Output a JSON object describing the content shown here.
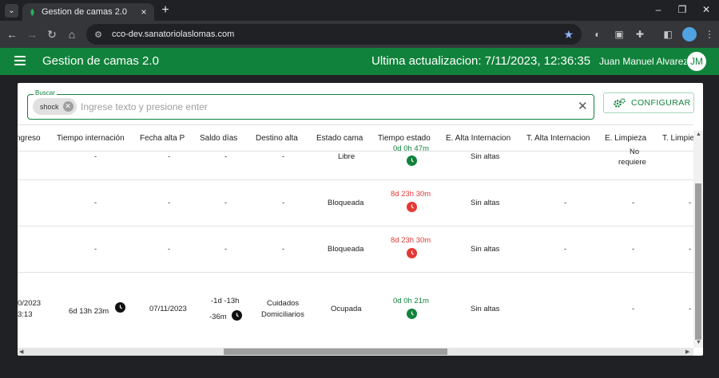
{
  "browser": {
    "tab_title": "Gestion de camas 2.0",
    "url": "cco-dev.sanatoriolaslomas.com"
  },
  "header": {
    "app_title": "Gestion de camas 2.0",
    "last_update": "Ultima actualizacion: 7/11/2023, 12:36:35",
    "user_name": "Juan Manuel Alvarez",
    "avatar_initials": "JM",
    "brand_color": "#11823b"
  },
  "search": {
    "legend": "Buscar",
    "chip": "shock",
    "placeholder": "Ingrese texto y presione enter",
    "config_label": "CONFIGURAR"
  },
  "table": {
    "headers": [
      "ngreso",
      "Tiempo internación",
      "Fecha alta P",
      "Saldo días",
      "Destino alta",
      "Estado cama",
      "Tiempo estado",
      "E. Alta Internacion",
      "T. Alta Internacion",
      "E. Limpieza",
      "T. Limpie"
    ],
    "rows": [
      {
        "ingreso": "",
        "tiempo_internacion": "-",
        "fecha_alta": "-",
        "saldo_dias": "-",
        "destino_alta": "-",
        "estado_cama": "Libre",
        "tiempo_estado": "0d 0h 47m",
        "e_alta": "Sin altas",
        "t_alta": "",
        "e_limpieza_1": "No",
        "e_limpieza_2": "requiere",
        "t_limpieza": ""
      },
      {
        "ingreso": "",
        "tiempo_internacion": "-",
        "fecha_alta": "-",
        "saldo_dias": "-",
        "destino_alta": "-",
        "estado_cama": "Bloqueada",
        "tiempo_estado": "8d 23h 30m",
        "e_alta": "Sin altas",
        "t_alta": "-",
        "e_limpieza": "-",
        "t_limpieza": "-"
      },
      {
        "ingreso": "",
        "tiempo_internacion": "-",
        "fecha_alta": "-",
        "saldo_dias": "-",
        "destino_alta": "-",
        "estado_cama": "Bloqueada",
        "tiempo_estado": "8d 23h 30m",
        "e_alta": "Sin altas",
        "t_alta": "-",
        "e_limpieza": "-",
        "t_limpieza": "-"
      },
      {
        "ingreso_1": "0/2023",
        "ingreso_2": "3:13",
        "tiempo_internacion": "6d 13h 23m",
        "fecha_alta": "07/11/2023",
        "saldo_dias_1": "-1d -13h",
        "saldo_dias_2": "-36m",
        "destino_alta_1": "Cuidados",
        "destino_alta_2": "Domiciliarios",
        "estado_cama": "Ocupada",
        "tiempo_estado": "0d 0h 21m",
        "e_alta": "Sin altas",
        "t_alta": "",
        "e_limpieza": "-",
        "t_limpieza": "-"
      }
    ]
  },
  "icons": {
    "clock": "clock-icon",
    "gears": "gears-icon",
    "close": "close-icon",
    "menu": "hamburger-menu-icon"
  }
}
